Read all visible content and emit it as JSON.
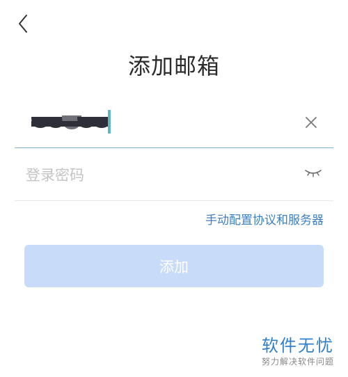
{
  "header": {
    "back_icon": "chevron-left-icon",
    "title": "添加邮箱"
  },
  "form": {
    "email": {
      "value_redacted": true,
      "clear_icon": "close-icon"
    },
    "password": {
      "placeholder": "登录密码",
      "value": "",
      "visibility_icon": "eye-closed-icon"
    },
    "manual_config_link": "手动配置协议和服务器",
    "submit_label": "添加",
    "submit_disabled": true
  },
  "colors": {
    "accent": "#3d7fbf",
    "active_underline": "#7fb0d0",
    "button_disabled_bg": "#c8dcf9"
  },
  "watermark": {
    "title": "软件无忧",
    "subtitle": "努力解决软件问题"
  }
}
